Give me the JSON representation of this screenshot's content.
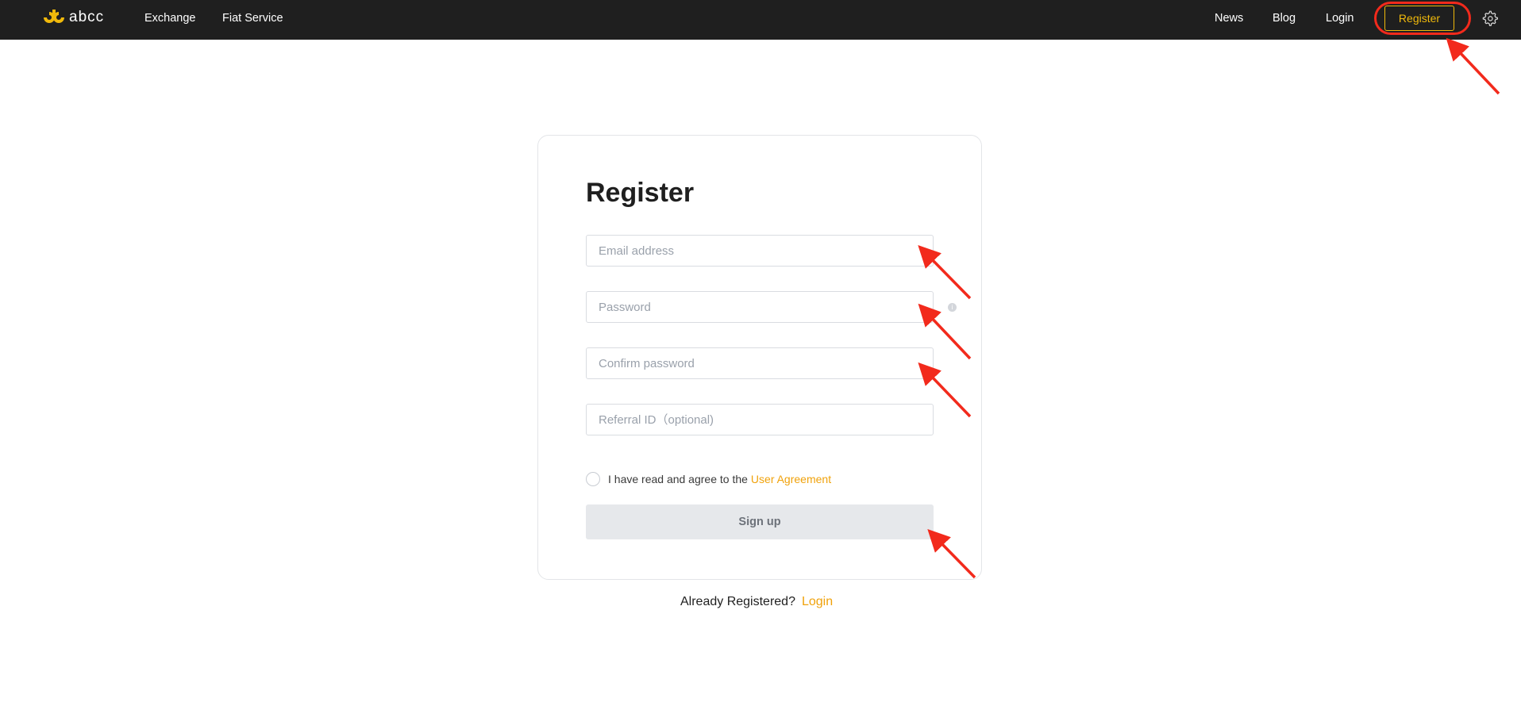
{
  "header": {
    "logo_text": "abcc",
    "nav_left": [
      "Exchange",
      "Fiat Service"
    ],
    "nav_right": [
      "News",
      "Blog",
      "Login"
    ],
    "register_button": "Register",
    "brand_color": "#f0b90b",
    "icons": [
      "abcc-logo-icon",
      "settings-gear-icon"
    ]
  },
  "form": {
    "title": "Register",
    "email_placeholder": "Email address",
    "password_placeholder": "Password",
    "confirm_placeholder": "Confirm password",
    "referral_placeholder": "Referral ID（optional)",
    "info_icon": "i",
    "agree_text": "I have read and agree to the",
    "agree_link": "User Agreement",
    "signup_label": "Sign up"
  },
  "footer": {
    "already_text": "Already Registered?",
    "login_link": "Login"
  },
  "annotations": {
    "color": "#f22a1c",
    "items": [
      "register-button-highlight",
      "arrow-register",
      "arrow-email",
      "arrow-password",
      "arrow-confirm",
      "arrow-signup"
    ]
  }
}
